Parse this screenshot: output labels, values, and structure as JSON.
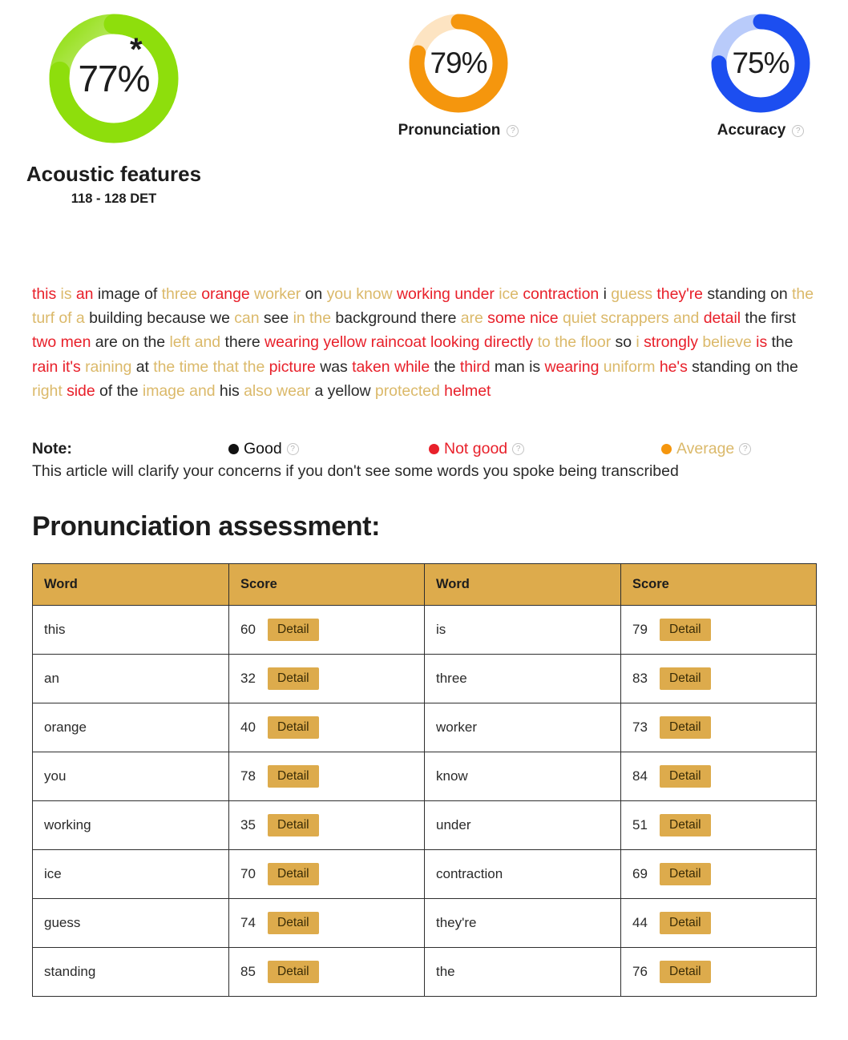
{
  "gauges": [
    {
      "name": "acoustic-features",
      "percent": 77,
      "value_label": "77%",
      "caption": "Acoustic features",
      "subtitle": "118 - 128 DET",
      "color": "#8ede0c",
      "track_color": "#e3f7bd",
      "has_star": true,
      "star": "*",
      "has_help": false,
      "size": "big"
    },
    {
      "name": "pronunciation",
      "percent": 79,
      "value_label": "79%",
      "caption": "Pronunciation",
      "color": "#f5960d",
      "track_color": "#fde4c2",
      "has_star": false,
      "has_help": true,
      "help_icon": "help-circle-icon",
      "size": "small"
    },
    {
      "name": "accuracy",
      "percent": 75,
      "value_label": "75%",
      "caption": "Accuracy",
      "color": "#1c4ef0",
      "track_color": "#b9cbfa",
      "has_star": false,
      "has_help": true,
      "help_icon": "help-circle-icon",
      "size": "small"
    }
  ],
  "transcript": {
    "words": [
      {
        "t": "this",
        "c": "bad"
      },
      {
        "t": "is",
        "c": "average"
      },
      {
        "t": "an",
        "c": "bad"
      },
      {
        "t": "image",
        "c": "good"
      },
      {
        "t": "of",
        "c": "good"
      },
      {
        "t": "three",
        "c": "average"
      },
      {
        "t": "orange",
        "c": "bad"
      },
      {
        "t": "worker",
        "c": "average"
      },
      {
        "t": "on",
        "c": "good"
      },
      {
        "t": "you",
        "c": "average"
      },
      {
        "t": "know",
        "c": "average"
      },
      {
        "t": "working",
        "c": "bad"
      },
      {
        "t": "under",
        "c": "bad"
      },
      {
        "t": "ice",
        "c": "average"
      },
      {
        "t": "contraction",
        "c": "bad"
      },
      {
        "t": "i",
        "c": "good"
      },
      {
        "t": "guess",
        "c": "average"
      },
      {
        "t": "they're",
        "c": "bad"
      },
      {
        "t": "standing",
        "c": "good"
      },
      {
        "t": "on",
        "c": "good"
      },
      {
        "t": "the",
        "c": "average"
      },
      {
        "t": "turf",
        "c": "average"
      },
      {
        "t": "of",
        "c": "average"
      },
      {
        "t": "a",
        "c": "average"
      },
      {
        "t": "building",
        "c": "good"
      },
      {
        "t": "because",
        "c": "good"
      },
      {
        "t": "we",
        "c": "good"
      },
      {
        "t": "can",
        "c": "average"
      },
      {
        "t": "see",
        "c": "good"
      },
      {
        "t": "in",
        "c": "average"
      },
      {
        "t": "the",
        "c": "average"
      },
      {
        "t": "background",
        "c": "good"
      },
      {
        "t": "there",
        "c": "good"
      },
      {
        "t": "are",
        "c": "average"
      },
      {
        "t": "some",
        "c": "bad"
      },
      {
        "t": "nice",
        "c": "bad"
      },
      {
        "t": "quiet",
        "c": "average"
      },
      {
        "t": "scrappers",
        "c": "average"
      },
      {
        "t": "and",
        "c": "average"
      },
      {
        "t": "detail",
        "c": "bad"
      },
      {
        "t": "the",
        "c": "good"
      },
      {
        "t": "first",
        "c": "good"
      },
      {
        "t": "two",
        "c": "bad"
      },
      {
        "t": "men",
        "c": "bad"
      },
      {
        "t": "are",
        "c": "good"
      },
      {
        "t": "on",
        "c": "good"
      },
      {
        "t": "the",
        "c": "good"
      },
      {
        "t": "left",
        "c": "average"
      },
      {
        "t": "and",
        "c": "average"
      },
      {
        "t": "there",
        "c": "good"
      },
      {
        "t": "wearing",
        "c": "bad"
      },
      {
        "t": "yellow",
        "c": "bad"
      },
      {
        "t": "raincoat",
        "c": "bad"
      },
      {
        "t": "looking",
        "c": "bad"
      },
      {
        "t": "directly",
        "c": "bad"
      },
      {
        "t": "to",
        "c": "average"
      },
      {
        "t": "the",
        "c": "average"
      },
      {
        "t": "floor",
        "c": "average"
      },
      {
        "t": "so",
        "c": "good"
      },
      {
        "t": "i",
        "c": "average"
      },
      {
        "t": "strongly",
        "c": "bad"
      },
      {
        "t": "believe",
        "c": "average"
      },
      {
        "t": "is",
        "c": "bad"
      },
      {
        "t": "the",
        "c": "good"
      },
      {
        "t": "rain",
        "c": "bad"
      },
      {
        "t": "it's",
        "c": "bad"
      },
      {
        "t": "raining",
        "c": "average"
      },
      {
        "t": "at",
        "c": "good"
      },
      {
        "t": "the",
        "c": "average"
      },
      {
        "t": "time",
        "c": "average"
      },
      {
        "t": "that",
        "c": "average"
      },
      {
        "t": "the",
        "c": "average"
      },
      {
        "t": "picture",
        "c": "bad"
      },
      {
        "t": "was",
        "c": "good"
      },
      {
        "t": "taken",
        "c": "bad"
      },
      {
        "t": "while",
        "c": "bad"
      },
      {
        "t": "the",
        "c": "good"
      },
      {
        "t": "third",
        "c": "bad"
      },
      {
        "t": "man",
        "c": "good"
      },
      {
        "t": "is",
        "c": "good"
      },
      {
        "t": "wearing",
        "c": "bad"
      },
      {
        "t": "uniform",
        "c": "average"
      },
      {
        "t": "he's",
        "c": "bad"
      },
      {
        "t": "standing",
        "c": "good"
      },
      {
        "t": "on",
        "c": "good"
      },
      {
        "t": "the",
        "c": "good"
      },
      {
        "t": "right",
        "c": "average"
      },
      {
        "t": "side",
        "c": "bad"
      },
      {
        "t": "of",
        "c": "good"
      },
      {
        "t": "the",
        "c": "good"
      },
      {
        "t": "image",
        "c": "average"
      },
      {
        "t": "and",
        "c": "average"
      },
      {
        "t": "his",
        "c": "good"
      },
      {
        "t": "also",
        "c": "average"
      },
      {
        "t": "wear",
        "c": "average"
      },
      {
        "t": "a",
        "c": "good"
      },
      {
        "t": "yellow",
        "c": "good"
      },
      {
        "t": "protected",
        "c": "average"
      },
      {
        "t": "helmet",
        "c": "bad"
      }
    ]
  },
  "note": {
    "label": "Note:",
    "legend": [
      {
        "text": "Good",
        "color": "#111111",
        "dot": "#111111",
        "help_icon": "help-circle-icon"
      },
      {
        "text": "Not good",
        "color": "#e8202a",
        "dot": "#e8202a",
        "help_icon": "help-circle-icon"
      },
      {
        "text": "Average",
        "color": "#dbb96a",
        "dot": "#f5960d",
        "help_icon": "help-circle-icon"
      }
    ]
  },
  "article_note": "This article will clarify your concerns if you don't see some words you spoke being transcribed",
  "section_title": "Pronunciation assessment:",
  "table": {
    "headers": [
      "Word",
      "Score",
      "Word",
      "Score"
    ],
    "detail_label": "Detail",
    "rows": [
      {
        "word1": "this",
        "score1": 60,
        "word2": "is",
        "score2": 79
      },
      {
        "word1": "an",
        "score1": 32,
        "word2": "three",
        "score2": 83
      },
      {
        "word1": "orange",
        "score1": 40,
        "word2": "worker",
        "score2": 73
      },
      {
        "word1": "you",
        "score1": 78,
        "word2": "know",
        "score2": 84
      },
      {
        "word1": "working",
        "score1": 35,
        "word2": "under",
        "score2": 51
      },
      {
        "word1": "ice",
        "score1": 70,
        "word2": "contraction",
        "score2": 69
      },
      {
        "word1": "guess",
        "score1": 74,
        "word2": "they're",
        "score2": 44
      },
      {
        "word1": "standing",
        "score1": 85,
        "word2": "the",
        "score2": 76
      }
    ]
  }
}
